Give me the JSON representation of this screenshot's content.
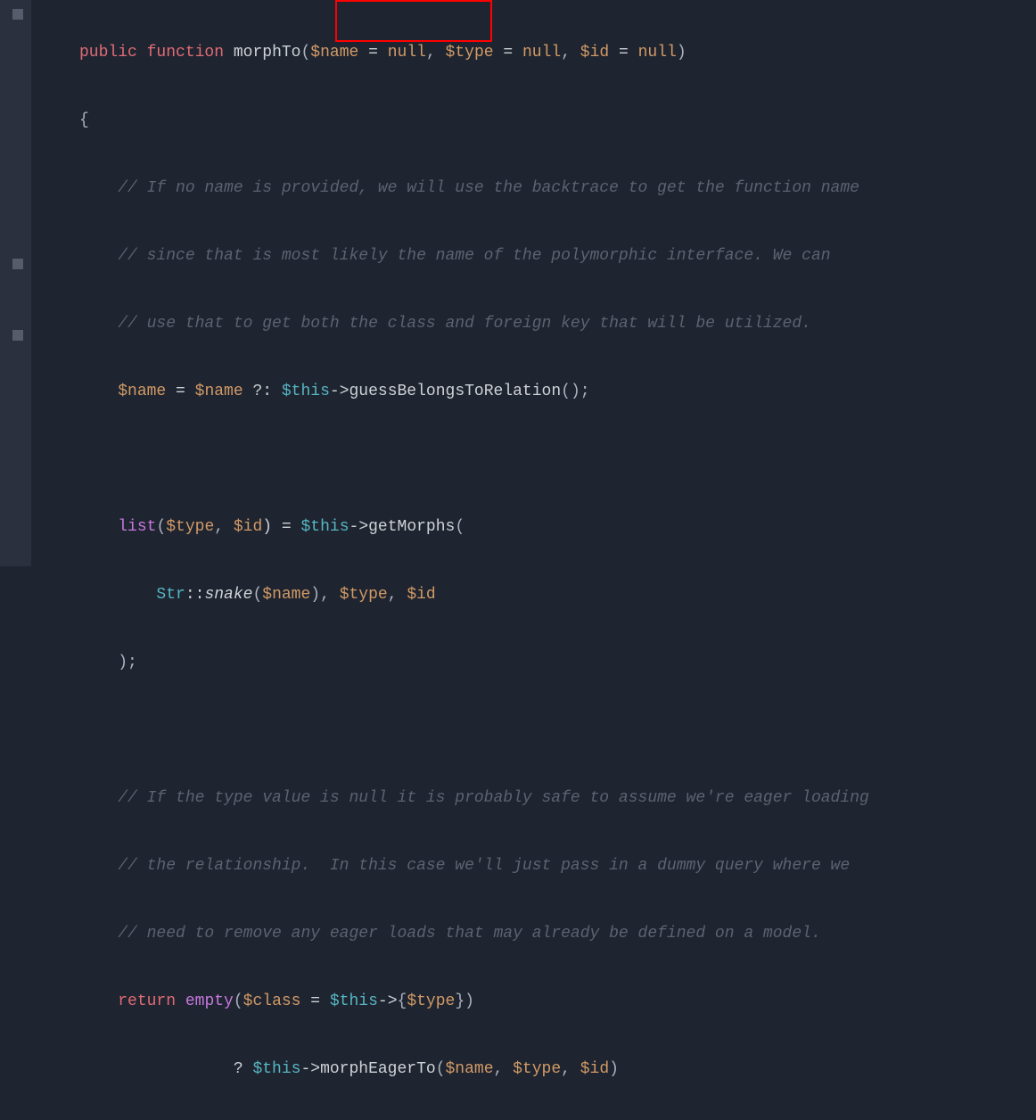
{
  "code": {
    "l1": {
      "kw_public": "public",
      "kw_function": "function",
      "fn_name": "morphTo",
      "lparen": "(",
      "p1_var": "$name",
      "eq": " = ",
      "p1_def": "null",
      "comma": ", ",
      "p2_var": "$type",
      "p2_def": "null",
      "p3_var": "$id",
      "p3_def": "null",
      "rparen": ")"
    },
    "l2": {
      "brace": "{"
    },
    "c1": "// If no name is provided, we will use the backtrace to get the function name",
    "c2": "// since that is most likely the name of the polymorphic interface. We can",
    "c3": "// use that to get both the class and foreign key that will be utilized.",
    "assign1": {
      "lhs": "$name",
      "eq": " = ",
      "rhs_var": "$name",
      "elvis": " ?: ",
      "this": "$this",
      "arrow": "->",
      "method": "guessBelongsToRelation",
      "call": "();"
    },
    "listline": {
      "list": "list",
      "open": "(",
      "a": "$type",
      "comma": ", ",
      "b": "$id",
      "close": ") = ",
      "this": "$this",
      "arrow": "->",
      "method": "getMorphs",
      "open2": "("
    },
    "strline": {
      "cls": "Str",
      "cc": "::",
      "snake": "snake",
      "open": "(",
      "arg": "$name",
      "close": "), ",
      "t": "$type",
      "comma": ", ",
      "i": "$id"
    },
    "closeparen": ");",
    "c4": "// If the type value is null it is probably safe to assume we're eager loading",
    "c5": "// the relationship.  In this case we'll just pass in a dummy query where we",
    "c6": "// need to remove any eager loads that may already be defined on a model.",
    "ret": {
      "return": "return",
      "empty": "empty",
      "open": "(",
      "class": "$class",
      "eq": " = ",
      "this": "$this",
      "arrow": "->",
      "lb": "{",
      "type": "$type",
      "rb": "}",
      "close": ")"
    },
    "tern": {
      "q": "? ",
      "this": "$this",
      "arrow": "->",
      "method": "morphEagerTo",
      "open": "(",
      "a": "$name",
      "c1": ", ",
      "b": "$type",
      "c2": ", ",
      "c": "$id",
      "close": ")"
    }
  }
}
